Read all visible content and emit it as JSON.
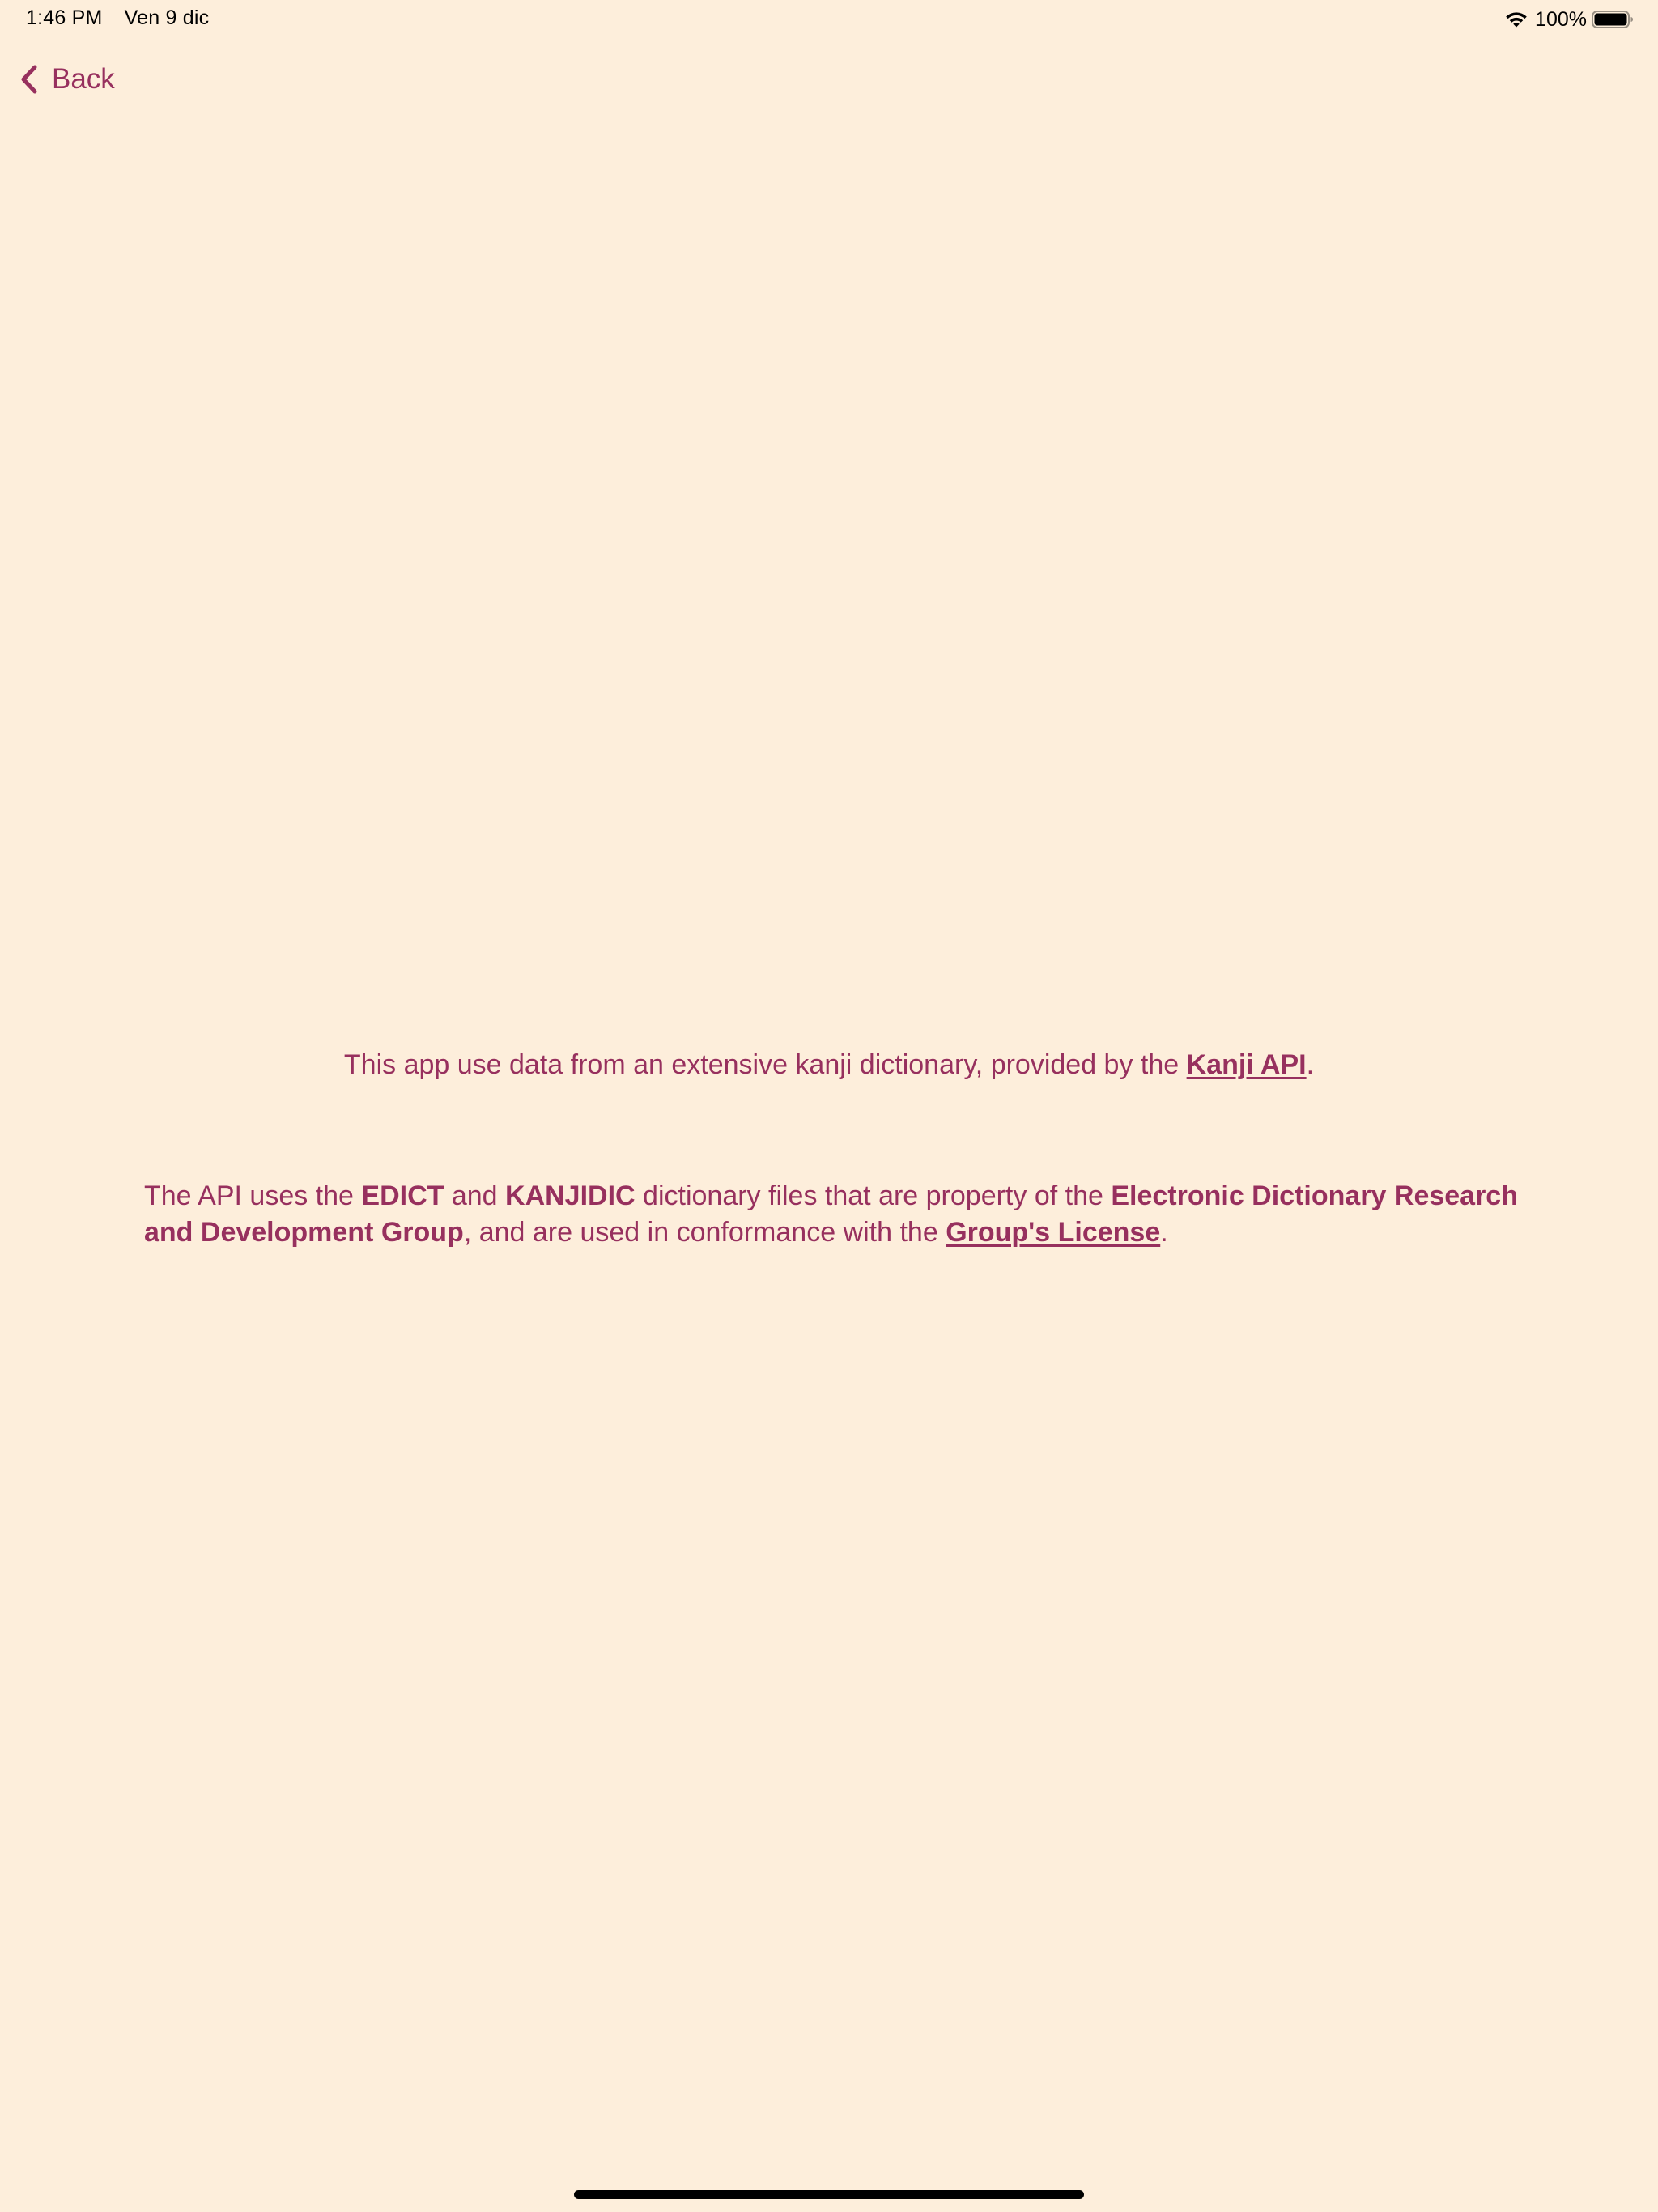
{
  "status_bar": {
    "time": "1:46 PM",
    "date": "Ven 9 dic",
    "battery_percent": "100%",
    "wifi_icon": "wifi-icon",
    "battery_icon": "battery-full-icon",
    "battery_level": 1.0
  },
  "nav": {
    "back_label": "Back",
    "back_icon": "chevron-left-icon"
  },
  "content": {
    "credit1": {
      "text_before": "This app use data from an extensive kanji dictionary, provided by the ",
      "link_label": "Kanji API",
      "text_after": "."
    },
    "credit2": {
      "t1": "The API uses the ",
      "b1": "EDICT",
      "t2": " and ",
      "b2": "KANJIDIC",
      "t3": " dictionary files that are property of the ",
      "b3": "Electronic Dictionary Research and Development Group",
      "t4": ", and are used in conformance with the ",
      "link_label": "Group's License",
      "t5": "."
    }
  },
  "colors": {
    "background": "#fdeedb",
    "accent": "#97305e",
    "status_text": "#000000"
  }
}
